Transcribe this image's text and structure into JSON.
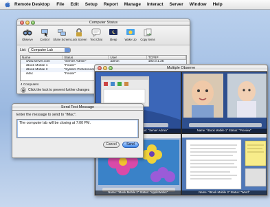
{
  "menubar": {
    "app_name": "Remote Desktop",
    "items": [
      "File",
      "Edit",
      "Setup",
      "Report",
      "Manage",
      "Interact",
      "Server",
      "Window",
      "Help"
    ]
  },
  "status_window": {
    "title": "Computer Status",
    "toolbar": [
      "Observe",
      "Control",
      "Share Screen",
      "Lock Screen",
      "Text Chat",
      "Sleep",
      "Wake Up",
      "Copy Items"
    ],
    "list_label": "List:",
    "list_value": "Computer Lab",
    "columns": [
      "Name",
      "Status",
      "User",
      "TCP/IP"
    ],
    "rows": [
      [
        "www.server.com",
        "\"Server Admin\"",
        "admin",
        "192.0.1.25"
      ],
      [
        "iBook Mobile 1",
        "\"Finder\"",
        "ericz",
        "192.0.1.86"
      ],
      [
        "iBook Mobile 2",
        "\"System Preferences\"",
        "",
        ""
      ],
      [
        "iMac",
        "\"Finder\"",
        "",
        ""
      ]
    ],
    "count": "4 Computers",
    "lock_text": "Click the lock to prevent further changes"
  },
  "observe_window": {
    "title": "Multiple Observe",
    "panes": [
      "Name: \"Server Admin\"   Status: \"Server Admin\"",
      "Name: \"iBook Mobile 1\"   Status: \"Preview\"",
      "Name: \"iBook Mobile 2\"   Status: \"AppleWorks\"",
      "Name: \"iBook Mobile 3\"   Status: \"Word\""
    ]
  },
  "message_window": {
    "title": "Send Text Message",
    "prompt": "Enter the message to send to \"iMac\".",
    "message": "The computer lab will be closing at 7:00 PM.",
    "cancel_label": "Cancel",
    "send_label": "Send"
  },
  "colors": {
    "accent": "#3f86e8",
    "desktop": "#9ab8e0"
  }
}
